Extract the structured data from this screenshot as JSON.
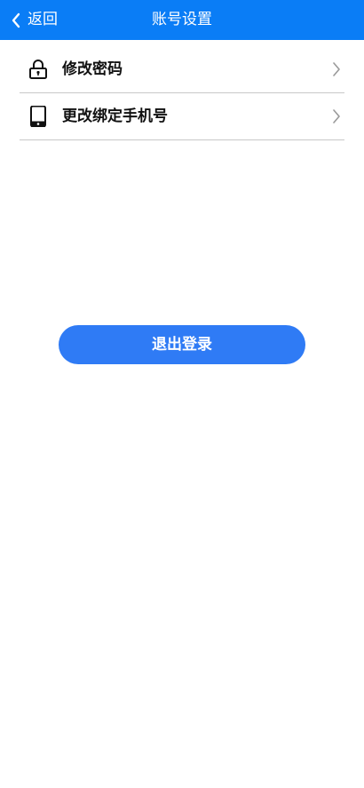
{
  "header": {
    "back_label": "返回",
    "title": "账号设置",
    "background_color": "#0a7df6"
  },
  "settings": {
    "items": [
      {
        "label": "修改密码",
        "icon": "lock-icon"
      },
      {
        "label": "更改绑定手机号",
        "icon": "phone-icon"
      }
    ]
  },
  "logout": {
    "label": "退出登录",
    "color": "#2f7bf5"
  }
}
